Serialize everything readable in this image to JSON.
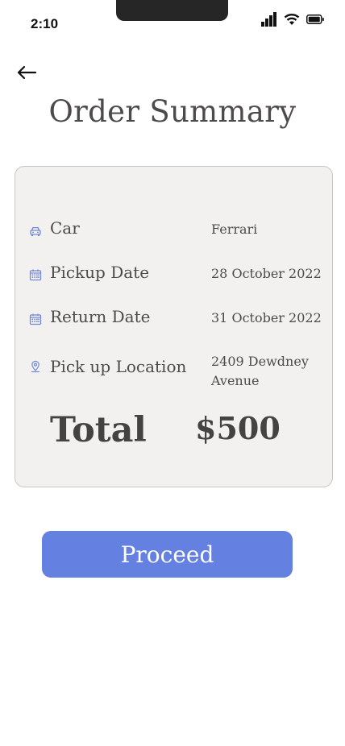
{
  "status_bar": {
    "time": "2:10"
  },
  "header": {
    "title": "Order Summary"
  },
  "summary": {
    "rows": [
      {
        "icon": "car-icon",
        "label": "Car",
        "value": "Ferrari"
      },
      {
        "icon": "calendar-icon",
        "label": "Pickup Date",
        "value": "28 October 2022"
      },
      {
        "icon": "calendar-icon",
        "label": "Return Date",
        "value": "31 October 2022"
      },
      {
        "icon": "location-pin-icon",
        "label": "Pick up Location",
        "value": "2409 Dewdney Avenue"
      }
    ],
    "total_label": "Total",
    "total_value": "$500"
  },
  "actions": {
    "proceed_label": "Proceed"
  },
  "colors": {
    "accent": "#6480e0",
    "card_bg": "#f3f1f0",
    "text": "#4d4a4a"
  }
}
